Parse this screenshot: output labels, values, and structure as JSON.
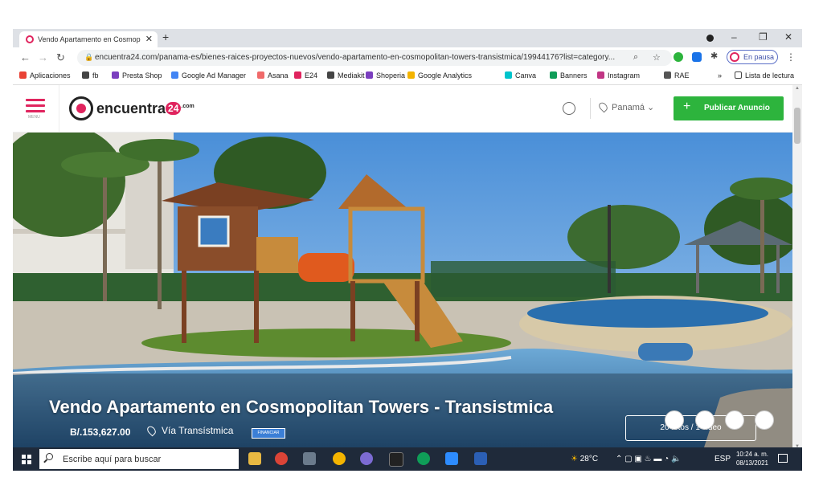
{
  "browser": {
    "tab_title": "Vendo Apartamento en Cosmopolitan Towers - Transistmica",
    "tab_close": "✕",
    "new_tab": "+",
    "url": "encuentra24.com/panama-es/bienes-raices-proyectos-nuevos/vendo-apartamento-en-cosmopolitan-towers-transistmica/19944176?list=category...",
    "profile_status": "En pausa",
    "window_controls": [
      "–",
      "❐",
      "✕"
    ]
  },
  "bookmarks": [
    {
      "label": "Aplicaciones",
      "color": "#e94235"
    },
    {
      "label": "fb",
      "color": "#444"
    },
    {
      "label": "Presta Shop",
      "color": "#7b3fbf"
    },
    {
      "label": "Google Ad Manager",
      "color": "#4285f4"
    },
    {
      "label": "Asana",
      "color": "#f06a6a"
    },
    {
      "label": "E24",
      "color": "#e0245e"
    },
    {
      "label": "Mediakit",
      "color": "#444"
    },
    {
      "label": "Shoperia",
      "color": "#7b3fbf"
    },
    {
      "label": "Google Analytics",
      "color": "#f4b400"
    },
    {
      "label": "Canva",
      "color": "#00c4cc"
    },
    {
      "label": "Banners",
      "color": "#0f9d58"
    },
    {
      "label": "Instagram",
      "color": "#c13584"
    },
    {
      "label": "RAE",
      "color": "#555"
    }
  ],
  "bookmarks_more": "»",
  "reading_list": "Lista de lectura",
  "site": {
    "menu_label": "MENU",
    "logo_text": "encuentra",
    "logo_badge": "24",
    "logo_suffix": ".com",
    "location": "Panamá",
    "publish_label": "Publicar Anuncio",
    "publish_color": "#2db43d",
    "brand_color": "#e0245e"
  },
  "listing": {
    "title": "Vendo Apartamento en Cosmopolitan Towers - Transistmica",
    "price": "B/.153,627.00",
    "location": "Vía Transístmica",
    "finance_badge": "FINANCIAR",
    "photo_count": "20 fotos / 1 video"
  },
  "taskbar": {
    "search_placeholder": "Escribe aquí para buscar",
    "weather": "28°C",
    "language": "ESP",
    "time": "10:24 a. m.",
    "date": "08/13/2021"
  }
}
